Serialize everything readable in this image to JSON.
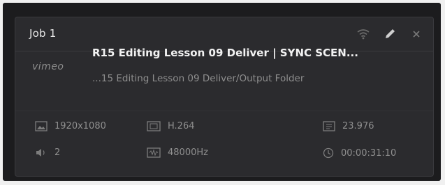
{
  "job": {
    "title": "Job 1",
    "brand": "vimeo",
    "name": "R15 Editing Lesson 09 Deliver | SYNC SCEN...",
    "path": "...15 Editing Lesson 09 Deliver/Output Folder"
  },
  "specs": {
    "resolution": "1920x1080",
    "codec": "H.264",
    "frame_rate": "23.976",
    "audio_channels": "2",
    "sample_rate": "48000Hz",
    "duration": "00:00:31:10"
  },
  "icons": {
    "signal": "wifi-icon",
    "edit": "pencil-icon",
    "close": "close-icon",
    "resolution": "image-icon",
    "codec": "film-icon",
    "frame_rate": "framerate-icon",
    "audio": "speaker-icon",
    "sample_rate": "waveform-icon",
    "duration": "clock-icon"
  },
  "colors": {
    "card_bg": "#2b2b2e",
    "frame_bg": "#1c1c1e",
    "text": "#f2f2f2",
    "muted": "#8f8f8f"
  }
}
